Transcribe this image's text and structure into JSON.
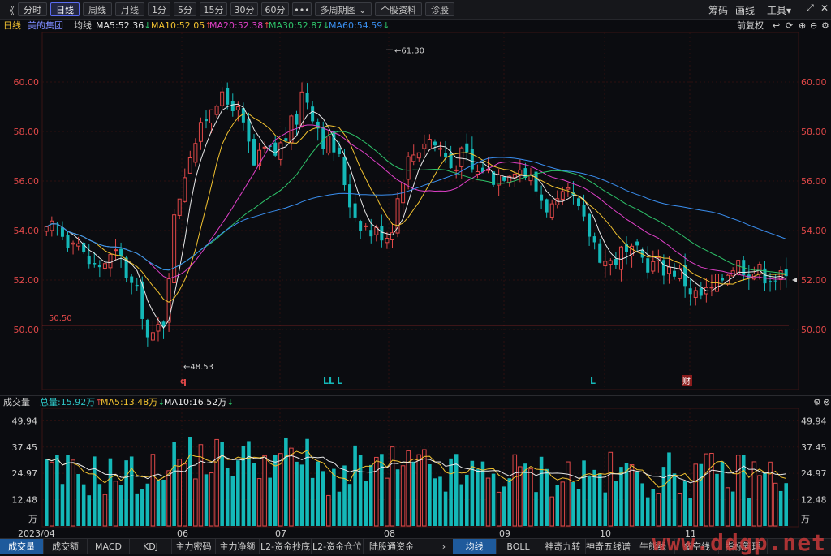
{
  "toolbar": {
    "back": "《",
    "periods": [
      "分时",
      "日线",
      "周线",
      "月线",
      "1分",
      "5分",
      "15分",
      "30分",
      "60分",
      "•••",
      "多周期图 ⌄",
      "个股资料",
      "诊股"
    ],
    "active_period": "日线",
    "right": [
      "筹码",
      "画线",
      "工具▾"
    ]
  },
  "legend": {
    "period": "日线",
    "stock": "美的集团",
    "avg_label": "均线",
    "ma": [
      {
        "text": "MA5:52.36",
        "arrow": "↓",
        "color": "#e8e8e8"
      },
      {
        "text": "MA10:52.05",
        "arrow": "↑",
        "color": "#f2c230"
      },
      {
        "text": "MA20:52.38",
        "arrow": "↑",
        "color": "#e040c8"
      },
      {
        "text": "MA30:52.87",
        "arrow": "↓",
        "color": "#2ec46a"
      },
      {
        "text": "MA60:54.59",
        "arrow": "↓",
        "color": "#3a8ff0"
      }
    ],
    "adjust": "前复权"
  },
  "chart_data": [
    {
      "type": "candlestick",
      "title": "美的集团 日线",
      "y_ticks": [
        "60.00",
        "58.00",
        "56.00",
        "54.00",
        "52.00",
        "50.00"
      ],
      "ylim": [
        48.0,
        62.0
      ],
      "x_labels": [
        "2023/04",
        "06",
        "07",
        "08",
        "09",
        "10",
        "11"
      ],
      "annotations": [
        {
          "text": "61.30",
          "kind": "high"
        },
        {
          "text": "48.53",
          "kind": "low"
        },
        {
          "text": "50.50",
          "kind": "line"
        }
      ],
      "markers": [
        "q",
        "LL",
        "L",
        "L",
        "财"
      ],
      "current_price": "52.00",
      "ma_last": {
        "MA5": 52.36,
        "MA10": 52.05,
        "MA20": 52.38,
        "MA30": 52.87,
        "MA60": 54.59
      }
    },
    {
      "type": "bar",
      "title": "成交量",
      "y_ticks": [
        "49.94",
        "37.45",
        "24.97",
        "12.48",
        "万"
      ],
      "ylim": [
        0,
        52
      ],
      "series_labels": [
        {
          "text": "总量:15.92万",
          "arrow": "↑",
          "color": "#2ec4c4"
        },
        {
          "text": "MA5:13.48万",
          "arrow": "↓",
          "color": "#f2c230"
        },
        {
          "text": "MA10:16.52万",
          "arrow": "↓",
          "color": "#e8e8e8"
        }
      ]
    }
  ],
  "volume_bar": {
    "title": "成交量"
  },
  "tabs_left": [
    "成交量",
    "成交额",
    "MACD",
    "KDJ",
    "主力密码",
    "主力净额",
    "L2-资金抄底",
    "L2-资金仓位",
    "陆股通资金"
  ],
  "tabs_right": [
    "均线",
    "BOLL",
    "神奇九转",
    "神奇五线谱",
    "牛熊线",
    "多空线",
    "指标管理"
  ],
  "active_tab_left": "成交量",
  "active_tab_right": "均线",
  "watermark": "www.ddgp.net",
  "colors": {
    "up": "#e04848",
    "down": "#14b8b8",
    "bg": "#0b0c10",
    "grid": "#3a1414"
  }
}
